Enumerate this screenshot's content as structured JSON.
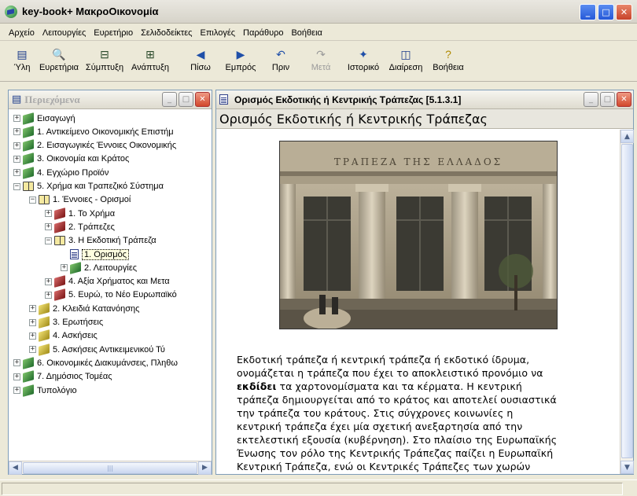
{
  "window": {
    "title": "key-book+  ΜακροΟικονομία"
  },
  "menu": [
    "Αρχείο",
    "Λειτουργίες",
    "Ευρετήριο",
    "Σελιδοδείκτες",
    "Επιλογές",
    "Παράθυρο",
    "Βοήθεια"
  ],
  "toolbar": [
    {
      "label": "Ύλη",
      "icon": "contents-icon",
      "glyph": "▤",
      "color": "#1a3a8a",
      "disabled": false
    },
    {
      "label": "Ευρετήρια",
      "icon": "search-icon",
      "glyph": "🔍",
      "color": "#1a3a8a",
      "disabled": false
    },
    {
      "label": "Σύμπτυξη",
      "icon": "collapse-icon",
      "glyph": "⊟",
      "color": "#2a4a2a",
      "disabled": false
    },
    {
      "label": "Ανάπτυξη",
      "icon": "expand-icon",
      "glyph": "⊞",
      "color": "#2a4a2a",
      "disabled": false
    },
    {
      "label": "Πίσω",
      "icon": "back-arrow-icon",
      "glyph": "◀",
      "color": "#1f4fa8",
      "disabled": false
    },
    {
      "label": "Εμπρός",
      "icon": "forward-arrow-icon",
      "glyph": "▶",
      "color": "#1f4fa8",
      "disabled": false
    },
    {
      "label": "Πριν",
      "icon": "undo-icon",
      "glyph": "↶",
      "color": "#1f4fa8",
      "disabled": false
    },
    {
      "label": "Μετά",
      "icon": "redo-icon",
      "glyph": "↷",
      "color": "#9a9a9a",
      "disabled": true
    },
    {
      "label": "Ιστορικό",
      "icon": "history-icon",
      "glyph": "✦",
      "color": "#1f4fa8",
      "disabled": false
    },
    {
      "label": "Διαίρεση",
      "icon": "split-view-icon",
      "glyph": "◫",
      "color": "#1a3a8a",
      "disabled": false
    },
    {
      "label": "Βοήθεια",
      "icon": "help-icon",
      "glyph": "?",
      "color": "#b08a00",
      "disabled": false
    }
  ],
  "left_pane": {
    "title": "Περιεχόμενα",
    "tree": [
      {
        "level": 0,
        "exp": "+",
        "icon": "green",
        "label": "Εισαγωγή"
      },
      {
        "level": 0,
        "exp": "+",
        "icon": "green",
        "label": "1.  Αντικείμενο Οικονομικής Επιστήμ"
      },
      {
        "level": 0,
        "exp": "+",
        "icon": "green",
        "label": "2.  Εισαγωγικές Έννοιες Οικονομικής"
      },
      {
        "level": 0,
        "exp": "+",
        "icon": "green",
        "label": "3.  Οικονομία και Κράτος"
      },
      {
        "level": 0,
        "exp": "+",
        "icon": "green",
        "label": "4.  Εγχώριο Προϊόν"
      },
      {
        "level": 0,
        "exp": "−",
        "icon": "open",
        "label": "5.  Χρήμα και Τραπεζικό Σύστημα"
      },
      {
        "level": 1,
        "exp": "−",
        "icon": "open",
        "label": "1.  Έννοιες - Ορισμοί"
      },
      {
        "level": 2,
        "exp": "+",
        "icon": "red",
        "label": "1.  Το Χρήμα"
      },
      {
        "level": 2,
        "exp": "+",
        "icon": "red",
        "label": "2.  Τράπεζες"
      },
      {
        "level": 2,
        "exp": "−",
        "icon": "open",
        "label": "3.  Η Εκδοτική Τράπεζα"
      },
      {
        "level": 3,
        "exp": "",
        "icon": "page",
        "label": "1.  Ορισμός",
        "selected": true
      },
      {
        "level": 3,
        "exp": "+",
        "icon": "green",
        "label": "2.  Λειτουργίες"
      },
      {
        "level": 2,
        "exp": "+",
        "icon": "red",
        "label": "4.  Αξία Χρήματος και Μετα"
      },
      {
        "level": 2,
        "exp": "+",
        "icon": "red",
        "label": "5.  Ευρώ, το Νέο Ευρωπαϊκό"
      },
      {
        "level": 1,
        "exp": "+",
        "icon": "yellow",
        "label": "2.  Κλειδιά Κατανόησης"
      },
      {
        "level": 1,
        "exp": "+",
        "icon": "yellow",
        "label": "3.  Ερωτήσεις"
      },
      {
        "level": 1,
        "exp": "+",
        "icon": "yellow",
        "label": "4.  Ασκήσεις"
      },
      {
        "level": 1,
        "exp": "+",
        "icon": "yellow",
        "label": "5.  Ασκήσεις Αντικειμενικού Τύ"
      },
      {
        "level": 0,
        "exp": "+",
        "icon": "green",
        "label": "6.  Οικονομικές Διακυμάνσεις, Πληθω"
      },
      {
        "level": 0,
        "exp": "+",
        "icon": "green",
        "label": "7.  Δημόσιος Τομέας"
      },
      {
        "level": 0,
        "exp": "+",
        "icon": "green",
        "label": "Τυπολόγιο"
      }
    ]
  },
  "right_pane": {
    "title": "Ορισμός Εκδοτικής ή Κεντρικής Τράπεζας   [5.1.3.1]",
    "page_heading": "Ορισμός Εκδοτικής ή Κεντρικής Τράπεζας",
    "photo_sign": "ΤΡΑΠΕΖΑ ΤΗΣ ΕΛΛΑΔΟΣ",
    "para_lines": [
      {
        "pre": "Εκδοτική τράπεζα ή κεντρική τράπεζα ή εκδοτικό ίδρυμα,",
        "bold": "",
        "post": ""
      },
      {
        "pre": "ονομάζεται η τράπεζα που έχει το αποκλειστικό προνόμιο να",
        "bold": "",
        "post": ""
      },
      {
        "pre": "",
        "bold": "εκδίδει",
        "post": " τα χαρτονομίσματα και τα κέρματα. Η κεντρική"
      },
      {
        "pre": "τράπεζα δημιουργείται από το κράτος και αποτελεί ουσιαστικά",
        "bold": "",
        "post": ""
      },
      {
        "pre": "την τράπεζα του κράτους. Στις σύγχρονες κοινωνίες η",
        "bold": "",
        "post": ""
      },
      {
        "pre": "κεντρική τράπεζα έχει μία σχετική ανεξαρτησία από την",
        "bold": "",
        "post": ""
      },
      {
        "pre": "εκτελεστική εξουσία (κυβέρνηση). Στο πλαίσιο της Ευρωπαϊκής",
        "bold": "",
        "post": ""
      },
      {
        "pre": "Ένωσης τον ρόλο της Κεντρικής Τράπεζας παίζει η Ευρωπαϊκή",
        "bold": "",
        "post": ""
      },
      {
        "pre": "Κεντρική Τράπεζα, ενώ οι Κεντρικές Τράπεζες των χωρών",
        "bold": "",
        "post": ""
      }
    ]
  }
}
